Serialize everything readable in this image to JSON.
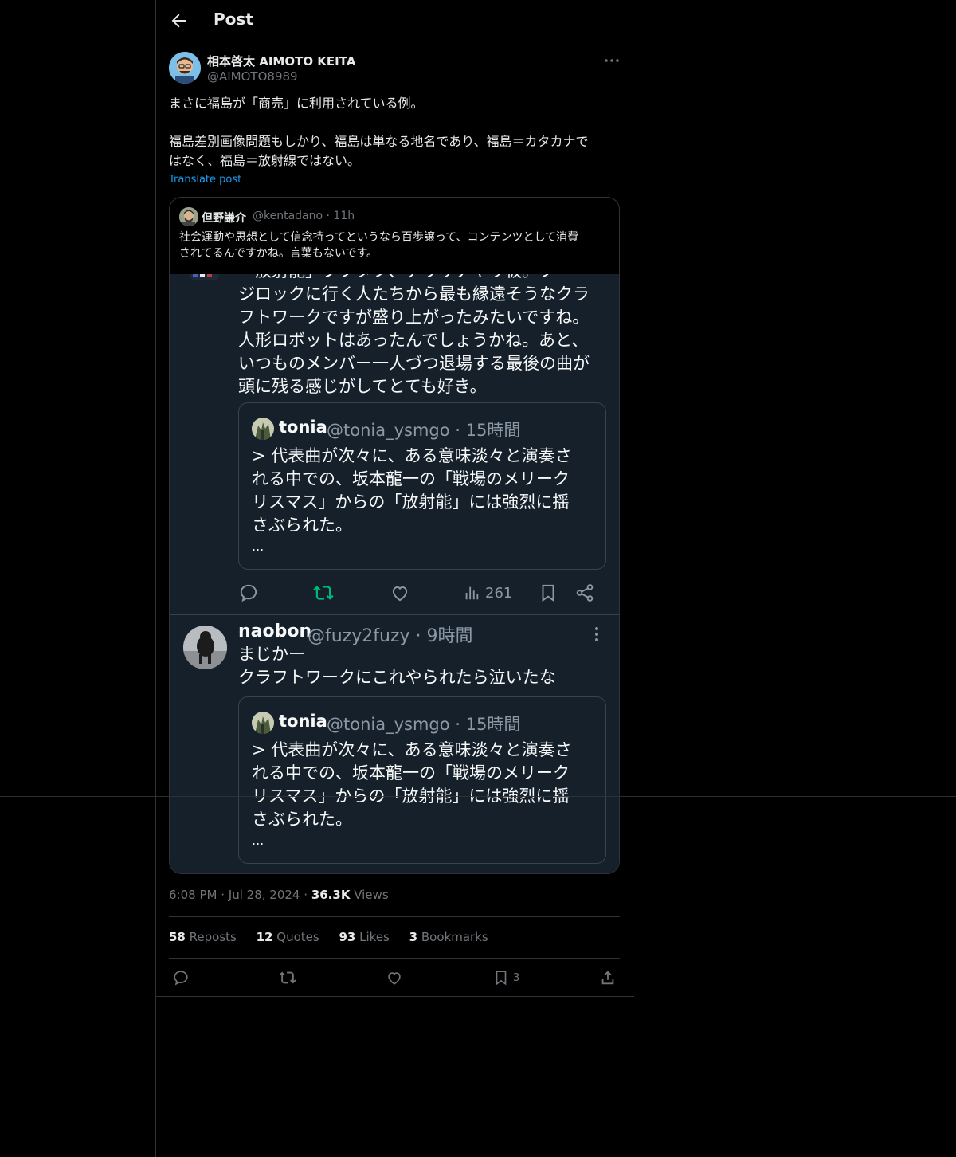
{
  "header": {
    "title": "Post"
  },
  "author": {
    "name": "相本啓太 AIMOTO KEITA",
    "handle": "@AIMOTO8989"
  },
  "post": {
    "lines": [
      "まさに福島が「商売」に利用されている例。",
      "",
      "福島差別画像問題もしかり、福島は単なる地名であり、福島＝カタカナで",
      "はなく、福島＝放射線ではない。"
    ],
    "translate": "Translate post"
  },
  "quote": {
    "name": "但野謙介",
    "handle": "@kentadano · 11h",
    "text_lines": [
      "社会運動や思想として信念持ってというなら百歩譲って、コンテンツとして消費",
      "されてるんですかね。言葉もないです。"
    ]
  },
  "screenshot": {
    "top_text": [
      "「放射能」ブフタフ、テリサナヤリ板。フ",
      "ジロックに行く人たちから最も縁遠そうなクラ",
      "フトワークですが盛り上がったみたいですね。",
      "人形ロボットはあったんでしょうかね。あと、",
      "いつものメンバー一人づつ退場する最後の曲が",
      "頭に残る感じがしてとても好き。"
    ],
    "embed1": {
      "name": "tonia",
      "handle": "@tonia_ysmgo · 15時間",
      "lines": [
        "> 代表曲が次々に、ある意味淡々と演奏さ",
        "れる中での、坂本龍一の「戦場のメリーク",
        "リスマス」からの「放射能」には強烈に揺",
        "さぶられた。",
        "..."
      ]
    },
    "actions": {
      "views": "261"
    },
    "reply": {
      "name": "naobon",
      "handle": "@fuzy2fuzy · 9時間",
      "lines": [
        "まじかー",
        "クラフトワークにこれやられたら泣いたな"
      ]
    },
    "embed2": {
      "name": "tonia",
      "handle": "@tonia_ysmgo · 15時間",
      "lines": [
        "> 代表曲が次々に、ある意味淡々と演奏さ",
        "れる中での、坂本龍一の「戦場のメリーク",
        "リスマス」からの「放射能」には強烈に揺",
        "さぶられた。",
        "..."
      ]
    }
  },
  "meta": {
    "time": "6:08 PM",
    "date": "Jul 28, 2024",
    "views_count": "36.3K",
    "views_label": "Views",
    "dot": "·"
  },
  "stats": {
    "reposts": {
      "count": "58",
      "label": "Reposts"
    },
    "quotes": {
      "count": "12",
      "label": "Quotes"
    },
    "likes": {
      "count": "93",
      "label": "Likes"
    },
    "bookmarks": {
      "count": "3",
      "label": "Bookmarks"
    }
  },
  "actions": {
    "bookmark_count": "3"
  },
  "colors": {
    "accent": "#1d9bf0",
    "retweet_green": "#00ba7c",
    "muted": "#71767b",
    "dim_bg": "#15202b"
  },
  "icons": [
    "back-arrow-icon",
    "more-icon",
    "reply-icon",
    "retweet-icon",
    "like-icon",
    "views-icon",
    "bookmark-icon",
    "share-icon"
  ]
}
